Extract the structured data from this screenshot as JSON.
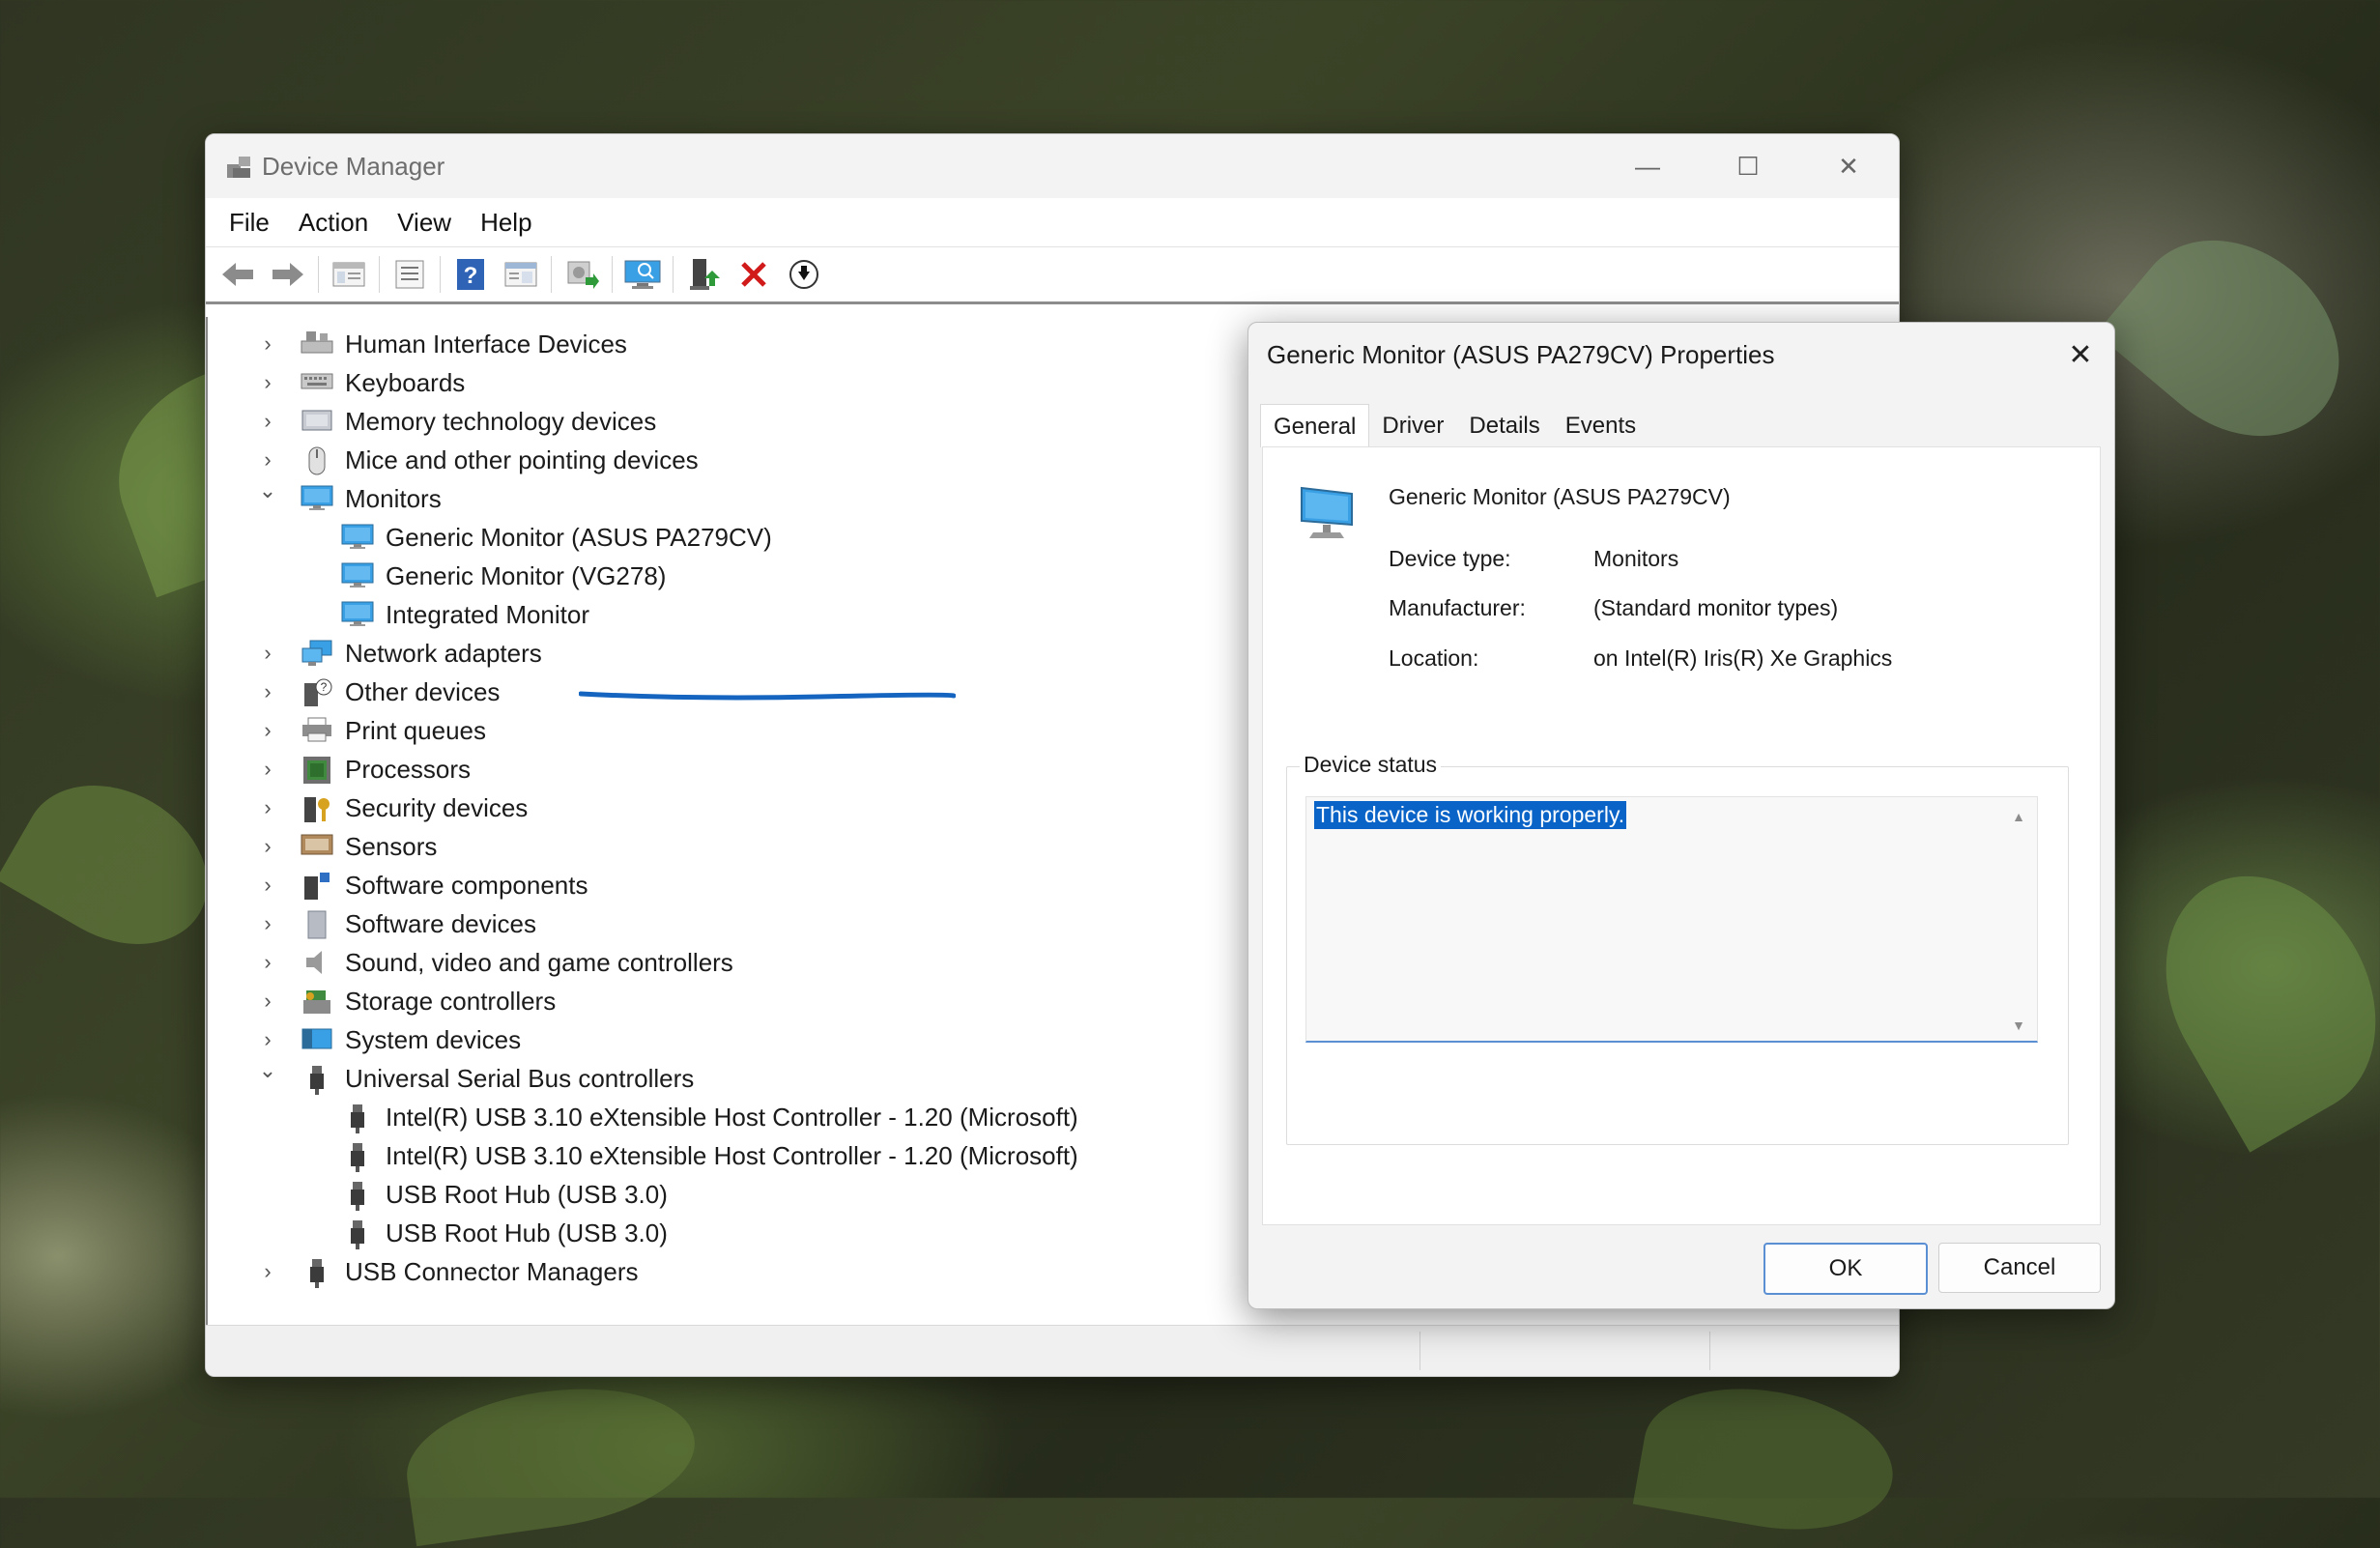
{
  "window": {
    "title": "Device Manager",
    "controls": {
      "minimize": "—",
      "maximize": "☐",
      "close": "✕"
    }
  },
  "menu": [
    "File",
    "Action",
    "View",
    "Help"
  ],
  "toolbar_icons": [
    "back-arrow-icon",
    "forward-arrow-icon",
    "show-hide-tree-icon",
    "properties-icon",
    "help-icon",
    "view-icon",
    "update-driver-icon",
    "scan-hardware-icon",
    "enable-device-icon",
    "uninstall-icon",
    "download-icon"
  ],
  "tree": [
    {
      "label": "Human Interface Devices",
      "level": 0,
      "expanded": false,
      "icon": "hid-icon"
    },
    {
      "label": "Keyboards",
      "level": 0,
      "expanded": false,
      "icon": "keyboard-icon"
    },
    {
      "label": "Memory technology devices",
      "level": 0,
      "expanded": false,
      "icon": "memory-icon"
    },
    {
      "label": "Mice and other pointing devices",
      "level": 0,
      "expanded": false,
      "icon": "mouse-icon"
    },
    {
      "label": "Monitors",
      "level": 0,
      "expanded": true,
      "icon": "monitor-icon"
    },
    {
      "label": "Generic Monitor (ASUS PA279CV)",
      "level": 1,
      "icon": "monitor-icon"
    },
    {
      "label": "Generic Monitor (VG278)",
      "level": 1,
      "icon": "monitor-icon"
    },
    {
      "label": "Integrated Monitor",
      "level": 1,
      "icon": "monitor-icon"
    },
    {
      "label": "Network adapters",
      "level": 0,
      "expanded": false,
      "icon": "network-icon"
    },
    {
      "label": "Other devices",
      "level": 0,
      "expanded": false,
      "icon": "unknown-device-icon"
    },
    {
      "label": "Print queues",
      "level": 0,
      "expanded": false,
      "icon": "printer-icon"
    },
    {
      "label": "Processors",
      "level": 0,
      "expanded": false,
      "icon": "processor-icon"
    },
    {
      "label": "Security devices",
      "level": 0,
      "expanded": false,
      "icon": "security-icon"
    },
    {
      "label": "Sensors",
      "level": 0,
      "expanded": false,
      "icon": "sensor-icon"
    },
    {
      "label": "Software components",
      "level": 0,
      "expanded": false,
      "icon": "software-component-icon"
    },
    {
      "label": "Software devices",
      "level": 0,
      "expanded": false,
      "icon": "software-device-icon"
    },
    {
      "label": "Sound, video and game controllers",
      "level": 0,
      "expanded": false,
      "icon": "speaker-icon"
    },
    {
      "label": "Storage controllers",
      "level": 0,
      "expanded": false,
      "icon": "storage-icon"
    },
    {
      "label": "System devices",
      "level": 0,
      "expanded": false,
      "icon": "system-icon"
    },
    {
      "label": "Universal Serial Bus controllers",
      "level": 0,
      "expanded": true,
      "icon": "usb-icon"
    },
    {
      "label": "Intel(R) USB 3.10 eXtensible Host Controller - 1.20 (Microsoft)",
      "level": 1,
      "icon": "usb-icon"
    },
    {
      "label": "Intel(R) USB 3.10 eXtensible Host Controller - 1.20 (Microsoft)",
      "level": 1,
      "icon": "usb-icon"
    },
    {
      "label": "USB Root Hub (USB 3.0)",
      "level": 1,
      "icon": "usb-icon"
    },
    {
      "label": "USB Root Hub (USB 3.0)",
      "level": 1,
      "icon": "usb-icon"
    },
    {
      "label": "USB Connector Managers",
      "level": 0,
      "expanded": false,
      "icon": "usb-icon"
    }
  ],
  "dialog": {
    "title": "Generic Monitor (ASUS PA279CV) Properties",
    "tabs": [
      "General",
      "Driver",
      "Details",
      "Events"
    ],
    "active_tab": "General",
    "device_name": "Generic Monitor (ASUS PA279CV)",
    "fields": [
      {
        "label": "Device type:",
        "value": "Monitors"
      },
      {
        "label": "Manufacturer:",
        "value": "(Standard monitor types)"
      },
      {
        "label": "Location:",
        "value": "on Intel(R) Iris(R) Xe Graphics"
      }
    ],
    "status_group_label": "Device status",
    "status_text": "This device is working properly.",
    "ok_label": "OK",
    "cancel_label": "Cancel"
  },
  "colors": {
    "accent": "#0a64c8",
    "annotation": "#1565c0",
    "monitor_blue": "#3aa0e6"
  }
}
